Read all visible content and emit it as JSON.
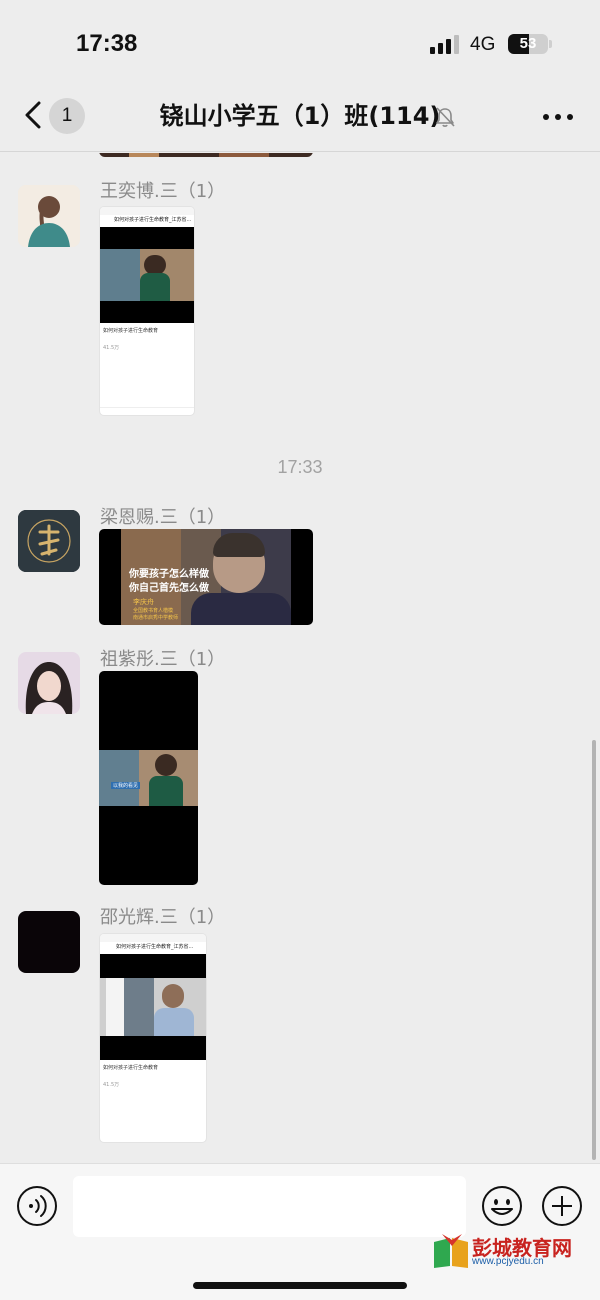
{
  "status_bar": {
    "time": "17:38",
    "network": "4G",
    "battery": "53",
    "battery_level": 0.53
  },
  "nav": {
    "unread_count": "1",
    "title": "铙山小学五（1）班(114)"
  },
  "chat": {
    "timestamp": "17:33",
    "messages": [
      {
        "sender": "王奕博.三（1）",
        "card_title": "如何对孩子进行生命教育_江苏省...",
        "card_caption": "如何对孩子进行生命教育",
        "card_views": "41.5万"
      },
      {
        "sender": "梁恩赐.三（1）",
        "video_line1": "你要孩子怎么样做",
        "video_line2": "你自己首先怎么做",
        "video_name": "李庆舟",
        "video_sub1": "全国教书育人楷模",
        "video_sub2": "南通市启秀中学教师"
      },
      {
        "sender": "祖紫彤.三（1）",
        "video_tag": "以我的看见"
      },
      {
        "sender": "邵光辉.三（1）",
        "card_title": "如何对孩子进行生命教育_江苏省...",
        "card_caption": "如何对孩子进行生命教育",
        "card_views": "41.5万"
      }
    ]
  },
  "watermark": {
    "brand": "彭城教育网",
    "url": "www.pcjyedu.cn"
  },
  "icons": [
    "signal-icon",
    "back-icon",
    "mute-icon",
    "more-icon",
    "voice-icon",
    "emoji-icon",
    "plus-icon"
  ]
}
